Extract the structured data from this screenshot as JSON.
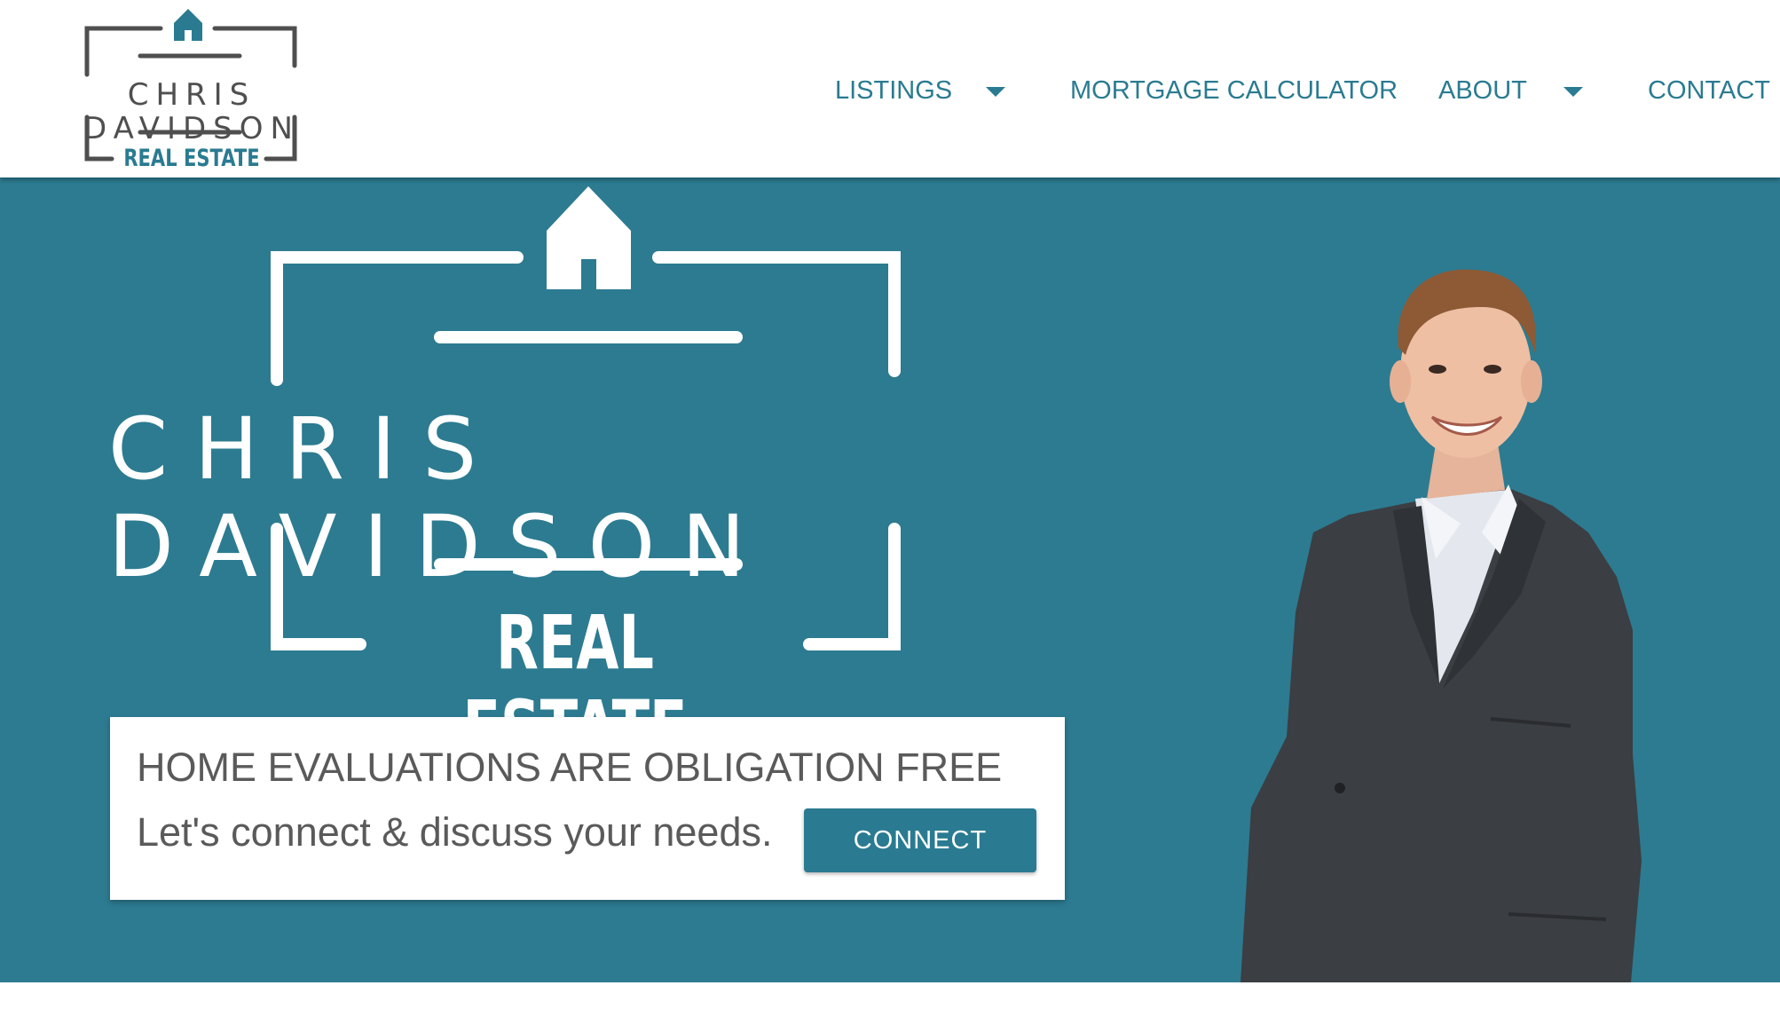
{
  "brand": {
    "name": "CHRIS DAVIDSON",
    "subtitle": "REAL ESTATE"
  },
  "nav": {
    "items": [
      {
        "label": "LISTINGS",
        "has_dropdown": true
      },
      {
        "label": "MORTGAGE CALCULATOR",
        "has_dropdown": false
      },
      {
        "label": "ABOUT",
        "has_dropdown": true
      },
      {
        "label": "CONTACT",
        "has_dropdown": false
      }
    ]
  },
  "hero": {
    "logo_name": "CHRIS DAVIDSON",
    "logo_subtitle": "REAL ESTATE",
    "cta": {
      "title": "HOME EVALUATIONS ARE OBLIGATION FREE",
      "text": "Let's connect & discuss your needs.",
      "button_label": "CONNECT"
    }
  },
  "colors": {
    "accent": "#2a7b91",
    "hero_background": "#2c7b91",
    "logo_gray": "#4f4f4f",
    "card_text": "#5a5a5a"
  },
  "icons": [
    "house-icon",
    "caret-down-icon"
  ]
}
